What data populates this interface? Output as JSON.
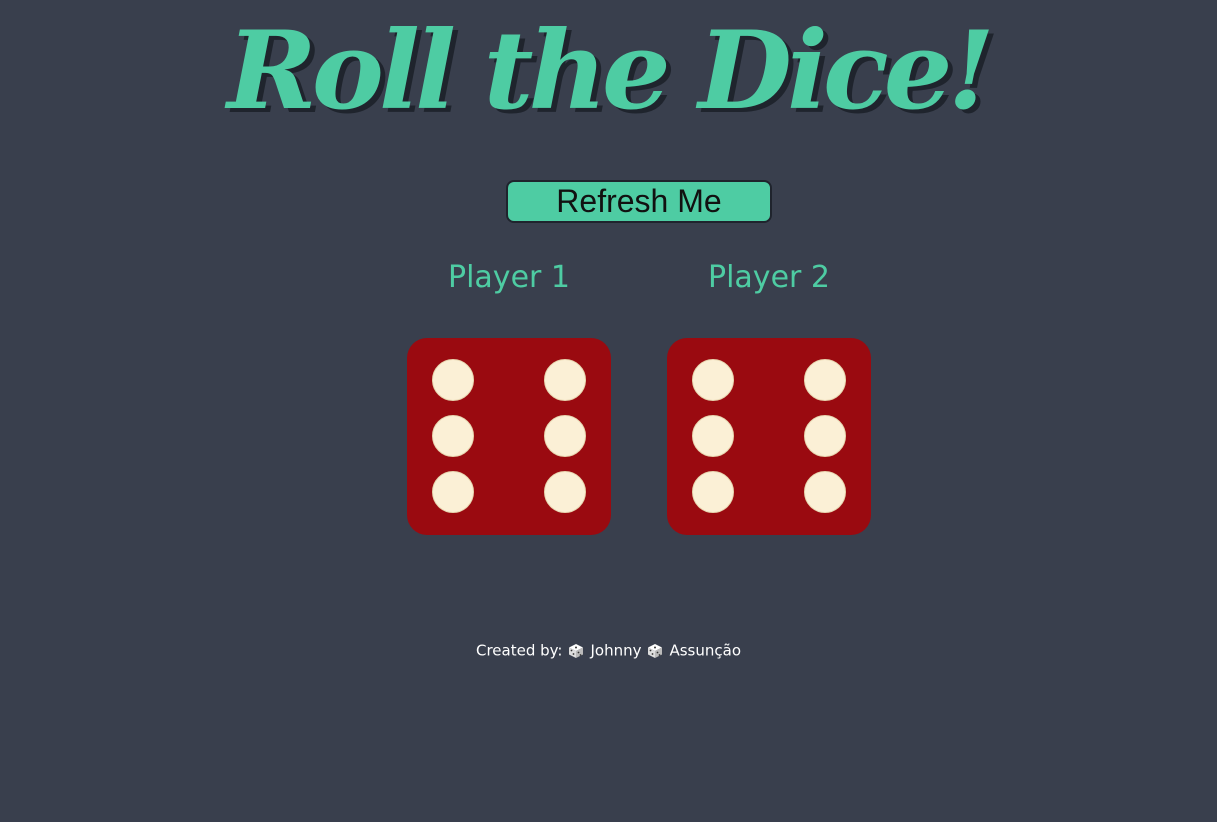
{
  "title": "Roll the Dice!",
  "refresh_button": {
    "label": "Refresh Me"
  },
  "players": [
    {
      "label": "Player 1",
      "die_value": 6
    },
    {
      "label": "Player 2",
      "die_value": 6
    }
  ],
  "footer": {
    "prefix": "Created by:",
    "first_name": "Johnny",
    "last_name": "Assunção",
    "separator_icon": "dice-icon"
  },
  "colors": {
    "background": "#393f4d",
    "accent": "#4ecca3",
    "die_face": "#9a0a10",
    "pip": "#fbf0d6"
  }
}
